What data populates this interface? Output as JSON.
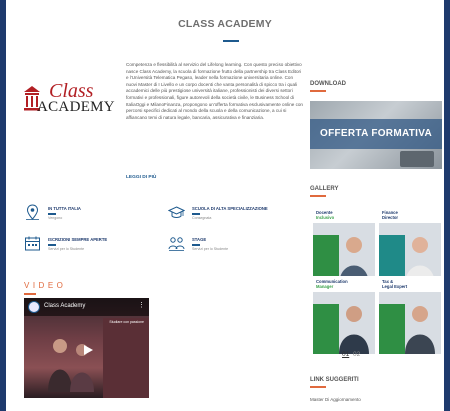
{
  "title": "CLASS ACADEMY",
  "logo": {
    "word1": "Class",
    "word2": "ACADEMY"
  },
  "intro": "Competenza e flessibilità al servizio del Lifelong learning. Con questo preciso obiettivo nasce Class Academy, la scuola di formazione frutto della partnership tra Class Editori e l'Università Telematica Pegaso, leader nella formazione universitaria online. Con nuovi Master di I Livello e un corpo docenti che vanta personalità di spicco tra i quali accademici delle più prestigiose università italiane, professionisti dei diversi settori formativi e professionali, figure autorevoli della società civile, le Business School di ItaliaOggi e MilanoFinanza, propongono un'offerta formativa esclusivamente online con percorsi specifici dedicati al mondo della scuola e della comunicazione, a cui si affiancano temi di natura legale, bancaria, assicurativa e finanziaria.",
  "read_more": "LEGGI DI PIÙ",
  "features": [
    {
      "icon": "map-pin-icon",
      "title": "IN TUTTA ITALIA",
      "sub": "Vengono"
    },
    {
      "icon": "graduation-cap-icon",
      "title": "SCUOLA DI ALTA SPECIALIZZAZIONE",
      "sub": "Consegnata"
    },
    {
      "icon": "calendar-icon",
      "title": "ISCRIZIONI SEMPRE APERTE",
      "sub": "Servizi per lo Studente"
    },
    {
      "icon": "students-icon",
      "title": "STAGE",
      "sub": "Servizi per lo Studente"
    }
  ],
  "video": {
    "heading": "VIDEO",
    "title": "Class Academy",
    "caption": "Studiare con passione"
  },
  "sidebar": {
    "download_heading": "DOWNLOAD",
    "offer_text": "OFFERTA FORMATIVA",
    "gallery_heading": "GALLERY",
    "gallery": [
      {
        "line1": "Docente",
        "line2": "Inclusivo"
      },
      {
        "line1": "Finance",
        "line2": "Director"
      },
      {
        "line1": "Communication",
        "line2": "Manager"
      },
      {
        "line1": "Tax &",
        "line2": "Legal Expert"
      }
    ],
    "pager": {
      "current": "01",
      "next": "02"
    },
    "links_heading": "LINK SUGGERITI",
    "links": [
      "Master Di Aggiornamento"
    ]
  },
  "colors": {
    "accent_blue": "#1e5a8e",
    "accent_orange": "#e06a3e",
    "brand_red": "#b21f24",
    "frame": "#1e3a6d"
  }
}
